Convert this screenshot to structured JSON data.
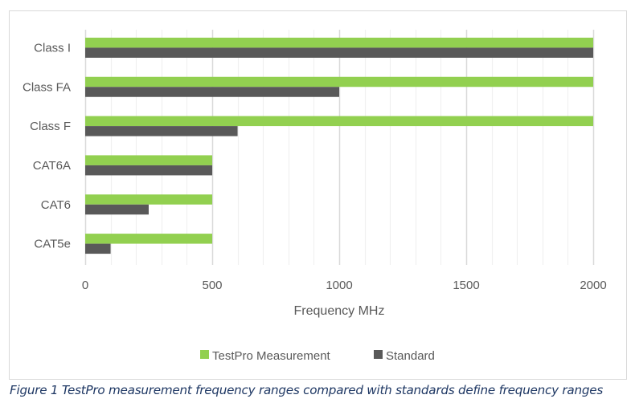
{
  "chart_data": {
    "type": "bar",
    "orientation": "horizontal",
    "categories": [
      "Class I",
      "Class FA",
      "Class F",
      "CAT6A",
      "CAT6",
      "CAT5e"
    ],
    "series": [
      {
        "name": "TestPro Measurement",
        "color": "#92d050",
        "values": [
          2000,
          2000,
          2000,
          500,
          500,
          500
        ]
      },
      {
        "name": "Standard",
        "color": "#595959",
        "values": [
          2000,
          1000,
          600,
          500,
          250,
          100
        ]
      }
    ],
    "title": "",
    "xlabel": "Frequency MHz",
    "ylabel": "",
    "xlim": [
      0,
      2000
    ],
    "xticks": [
      0,
      500,
      1000,
      1500,
      2000
    ],
    "tick_labels": [
      "0",
      "500",
      "1000",
      "1500",
      "2000"
    ],
    "major_grid_step": 500,
    "minor_grid_step": 100,
    "grid": true,
    "legend_position": "bottom"
  },
  "caption": "Figure 1 TestPro measurement frequency ranges compared with standards define frequency ranges"
}
